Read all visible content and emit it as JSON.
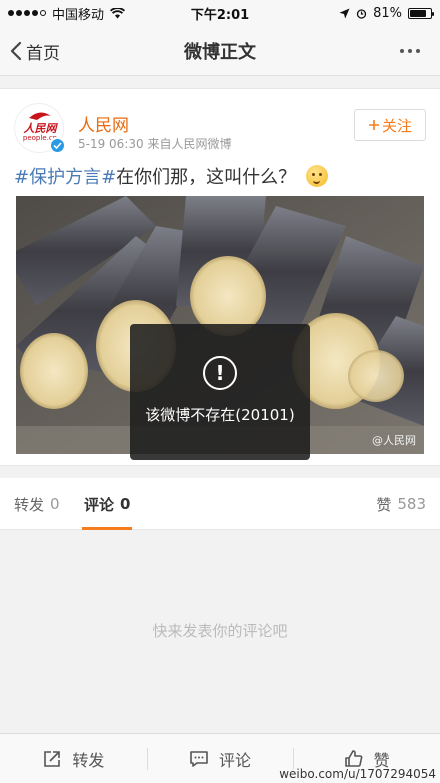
{
  "status_bar": {
    "carrier": "中国移动",
    "time": "下午2:01",
    "battery": "81%",
    "battery_level": 0.81
  },
  "nav": {
    "back_label": "首页",
    "title": "微博正文"
  },
  "post": {
    "author": "人民网",
    "avatar_logo": "人民网",
    "avatar_sub": "people.cn",
    "meta": "5-19 06:30  来自人民网微博",
    "follow_label": "关注",
    "hashtag": "#保护方言#",
    "text": "在你们那，这叫什么？",
    "photo_watermark": "@人民网"
  },
  "toast": {
    "text": "该微博不存在(20101)"
  },
  "tabs": {
    "repost_label": "转发",
    "repost_count": "0",
    "comment_label": "评论",
    "comment_count": "0",
    "like_label": "赞",
    "like_count": "583"
  },
  "comments": {
    "empty_text": "快来发表你的评论吧"
  },
  "toolbar": {
    "repost_label": "转发",
    "comment_label": "评论",
    "like_label": "赞",
    "watermark": "weibo.com/u/1707294054"
  },
  "colors": {
    "accent": "#f77c1b",
    "author": "#e86b0f",
    "hashtag": "#4a7bb6",
    "verified": "#2a9ae4"
  }
}
